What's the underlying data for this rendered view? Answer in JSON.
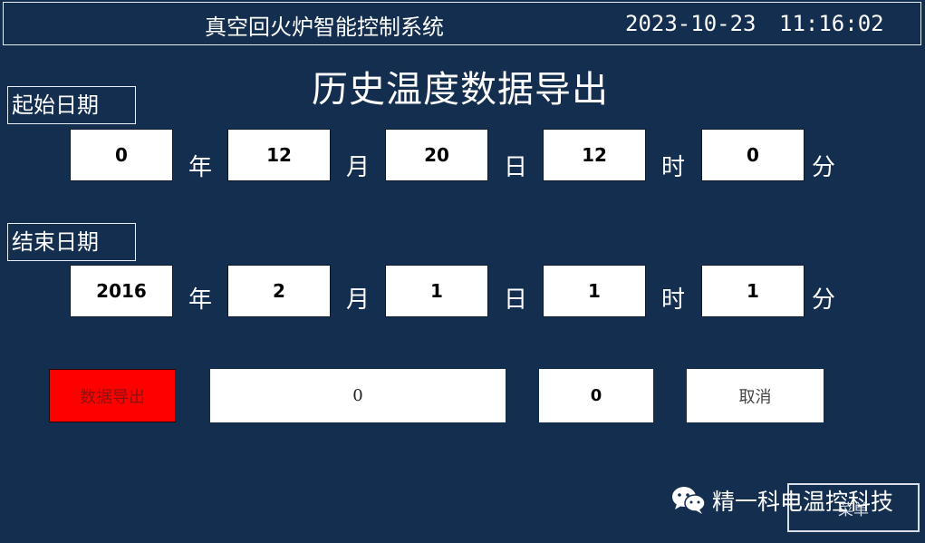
{
  "header": {
    "app_title": "真空回火炉智能控制系统",
    "date": "2023-10-23",
    "time": "11:16:02"
  },
  "page_title": "历史温度数据导出",
  "start": {
    "label": "起始日期",
    "year": "0",
    "month": "12",
    "day": "20",
    "hour": "12",
    "minute": "0"
  },
  "end": {
    "label": "结束日期",
    "year": "2016",
    "month": "2",
    "day": "1",
    "hour": "1",
    "minute": "1"
  },
  "units": {
    "year": "年",
    "month": "月",
    "day": "日",
    "hour": "时",
    "minute": "分"
  },
  "actions": {
    "export_label": "数据导出",
    "progress_value": "0",
    "count_value": "0",
    "cancel_label": "取消",
    "menu_label": "菜单"
  },
  "watermark": {
    "text": "精一科电温控科技"
  },
  "colors": {
    "background": "#142e4f",
    "export_button": "#fe0000"
  }
}
